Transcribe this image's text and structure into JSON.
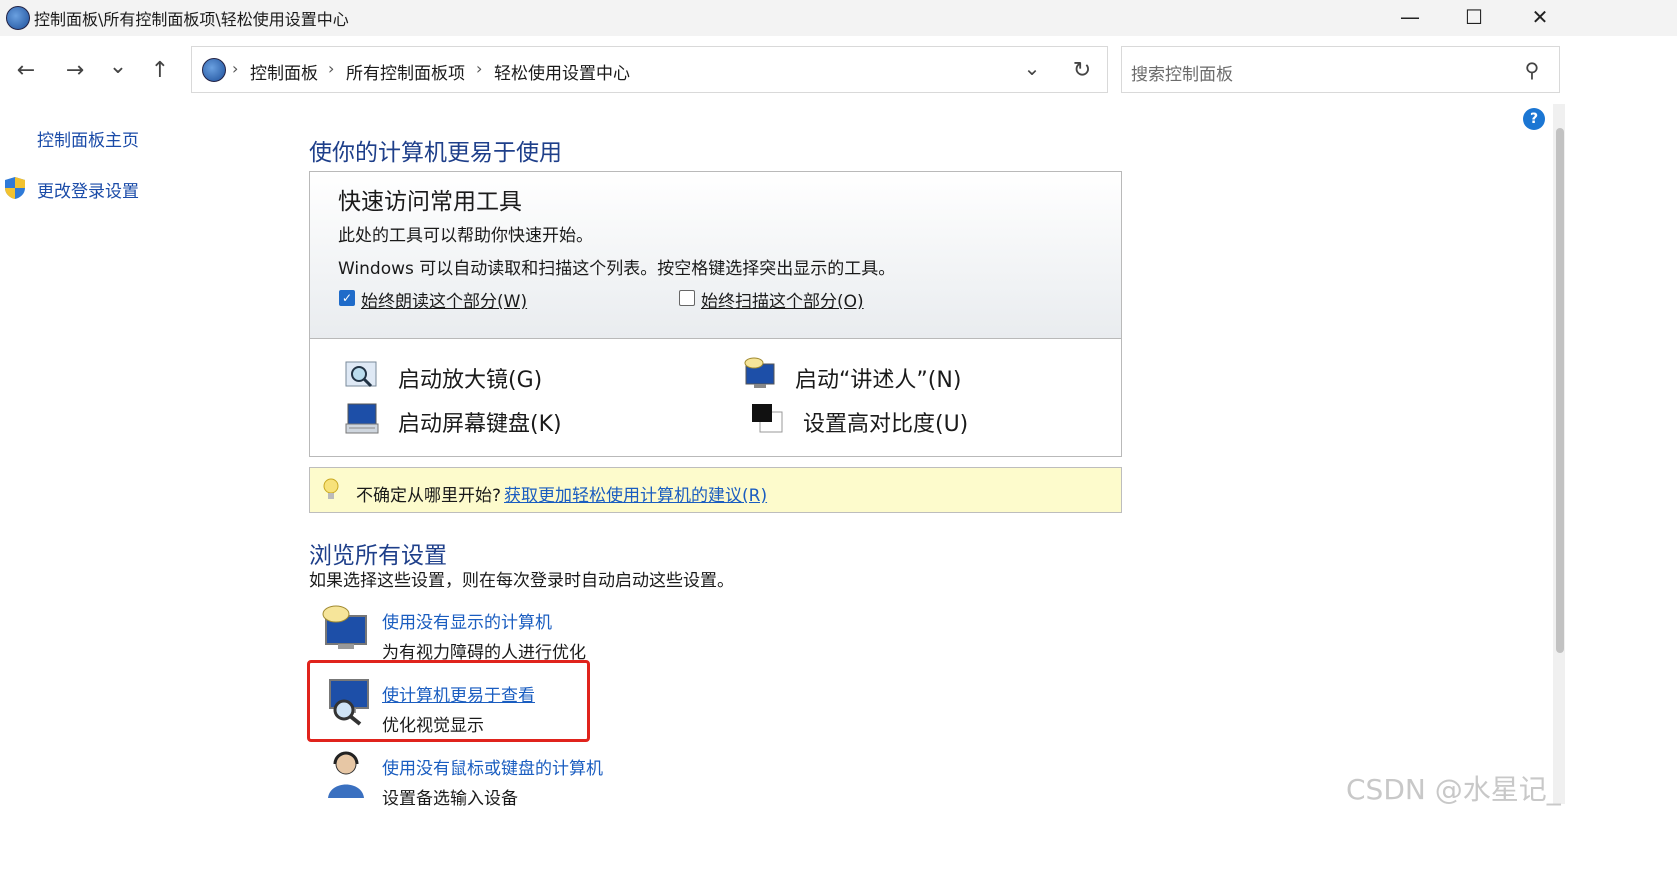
{
  "window": {
    "title": "控制面板\\所有控制面板项\\轻松使用设置中心",
    "minimize_icon": "—",
    "maximize_icon": "☐",
    "close_icon": "✕"
  },
  "nav": {
    "back_icon": "←",
    "forward_icon": "→",
    "recent_icon": "⌄",
    "up_icon": "↑",
    "breadcrumbs": [
      "控制面板",
      "所有控制面板项",
      "轻松使用设置中心"
    ],
    "crumb_sep": "›",
    "dropdown_icon": "⌄",
    "refresh_icon": "↻",
    "search_placeholder": "搜索控制面板",
    "search_icon": "⚲"
  },
  "sidebar": {
    "home": "控制面板主页",
    "login": "更改登录设置"
  },
  "main": {
    "heading": "使你的计算机更易于使用",
    "quick": {
      "title": "快速访问常用工具",
      "line1": "此处的工具可以帮助你快速开始。",
      "line2": "Windows 可以自动读取和扫描这个列表。按空格键选择突出显示的工具。",
      "check_read": "始终朗读这个部分(W)",
      "check_scan": "始终扫描这个部分(O)",
      "tools": {
        "magnifier": "启动放大镜(G)",
        "narrator": "启动“讲述人”(N)",
        "keyboard": "启动屏幕键盘(K)",
        "contrast": "设置高对比度(U)"
      }
    },
    "tip": {
      "prefix": "不确定从哪里开始?",
      "link": "获取更加轻松使用计算机的建议(R)"
    },
    "browse": {
      "heading": "浏览所有设置",
      "sub": "如果选择这些设置，则在每次登录时自动启动这些设置。",
      "items": [
        {
          "title": "使用没有显示的计算机",
          "desc": "为有视力障碍的人进行优化"
        },
        {
          "title": "使计算机更易于查看",
          "desc": "优化视觉显示"
        },
        {
          "title": "使用没有鼠标或键盘的计算机",
          "desc": "设置备选输入设备"
        }
      ]
    }
  },
  "help_icon": "?",
  "watermark": "CSDN @水星记_",
  "colors": {
    "link": "#1a5dc0",
    "heading": "#1e3f8a",
    "highlight_box": "#e0231c",
    "tip_bg": "#fdfbcc"
  }
}
